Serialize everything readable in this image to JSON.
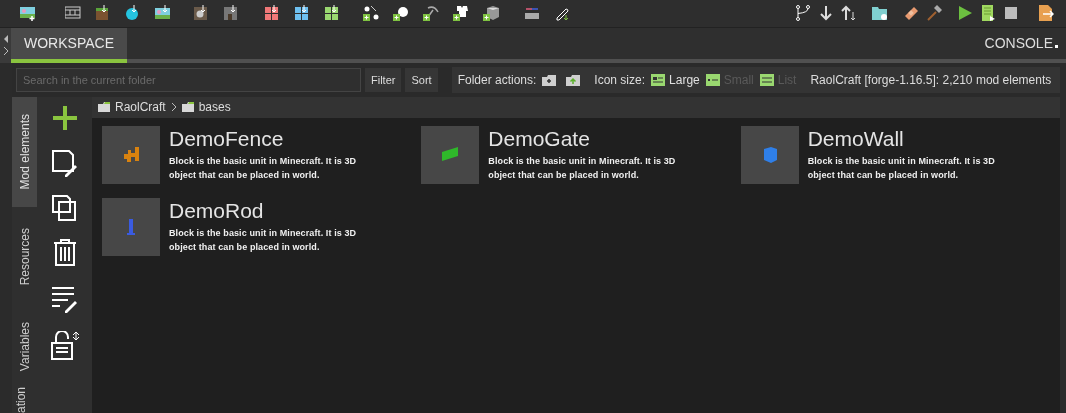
{
  "tabs": [
    {
      "label": "WORKSPACE",
      "selected": true
    }
  ],
  "console": {
    "label": "CONSOLE"
  },
  "search": {
    "placeholder": "Search in the current folder"
  },
  "buttons": [
    "Filter",
    "Sort"
  ],
  "folder_actions": {
    "label": "Folder actions:"
  },
  "icon_size": {
    "label": "Icon size:",
    "options": [
      {
        "label": "Large",
        "selected": true
      },
      {
        "label": "Small",
        "selected": false
      },
      {
        "label": "List",
        "selected": false
      }
    ]
  },
  "workspace_info": "RaolCraft [forge-1.16.5]: 2,210 mod elements",
  "side_tabs": [
    {
      "label": "Mod elements",
      "selected": true
    },
    {
      "label": "Resources",
      "selected": false
    },
    {
      "label": "Variables",
      "selected": false
    },
    {
      "label": "ation",
      "selected": false
    }
  ],
  "breadcrumb": [
    "RaolCraft",
    "bases"
  ],
  "elements": [
    {
      "name": "DemoFence",
      "description": "Block is the basic unit in Minecraft. It is 3D object that can be placed in world.",
      "color": "#d9820f"
    },
    {
      "name": "DemoGate",
      "description": "Block is the basic unit in Minecraft. It is 3D object that can be placed in world.",
      "color": "#2fb82a"
    },
    {
      "name": "DemoWall",
      "description": "Block is the basic unit in Minecraft. It is 3D object that can be placed in world.",
      "color": "#2f7fe8"
    },
    {
      "name": "DemoRod",
      "description": "Block is the basic unit in Minecraft. It is 3D object that can be placed in world.",
      "color": "#3a5be0"
    }
  ]
}
